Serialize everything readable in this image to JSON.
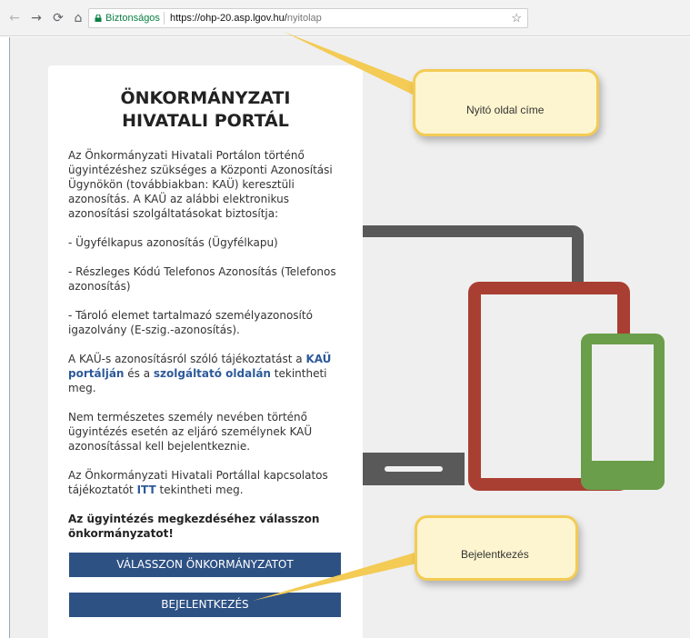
{
  "browser": {
    "secure_label": "Biztonságos",
    "url_host": "https://ohp-20.asp.lgov.hu/",
    "url_path": "nyitolap"
  },
  "card": {
    "title_line1": "ÖNKORMÁNYZATI",
    "title_line2": "HIVATALI PORTÁL",
    "intro": "Az Önkormányzati Hivatali Portálon történő ügyintézéshez szükséges a Központi Azonosítási Ügynökön (továbbiakban: KAÜ) keresztüli azonosítás. A KAÜ az alábbi elektronikus azonosítási szolgáltatásokat biztosítja:",
    "item1": "- Ügyfélkapus azonosítás (Ügyfélkapu)",
    "item2": "- Részleges Kódú Telefonos Azonosítás (Telefonos azonosítás)",
    "item3": "- Tároló elemet tartalmazó személyazonosító igazolvány (E-szig.-azonosítás).",
    "info_prefix": "A KAÜ-s azonosításról szóló tájékoztatást a ",
    "info_link1": "KAÜ portálján",
    "info_middle": " és a ",
    "info_link2": "szolgáltató oldalán",
    "info_suffix": " tekintheti meg.",
    "nonnatural": "Nem természetes személy nevében történő ügyintézés esetén az eljáró személynek KAÜ azonosítással kell bejelentkeznie.",
    "portal_prefix": "Az Önkormányzati Hivatali Portállal kapcsolatos tájékoztatót ",
    "portal_link": "ITT",
    "portal_suffix": " tekintheti meg.",
    "cta": "Az ügyintézés megkezdéséhez válasszon önkormányzatot!",
    "btn_choose": "VÁLASSZON ÖNKORMÁNYZATOT",
    "btn_login": "BEJELENTKEZÉS"
  },
  "callouts": {
    "title_note": "Nyitó oldal címe",
    "login_note": "Bejelentkezés"
  },
  "colors": {
    "button": "#2e5184",
    "link": "#2d5a9a",
    "callout_fill": "#fdf5cf",
    "callout_border": "#f3cb55",
    "monitor": "#595959",
    "tablet": "#a93f32",
    "phone": "#6a9e4a"
  }
}
